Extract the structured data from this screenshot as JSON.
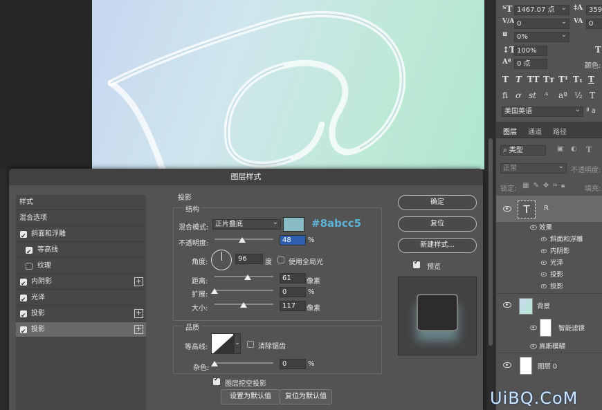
{
  "right_panel": {
    "font_size": "1467.07 点",
    "leading_partial": "359",
    "kerning": "0",
    "tracking": "0",
    "tsume": "0%",
    "vertical_scale": "100%",
    "baseline_shift": "0 点",
    "color_label": "颜色:",
    "language": "美国英语",
    "aa_label": "ª a",
    "tabs": [
      "图层",
      "通道",
      "路径"
    ],
    "filter_kind": "类型",
    "blend_mode": "正常",
    "opacity_label": "不透明度:",
    "lock_label": "锁定:",
    "fill_label": "填充:",
    "layers": {
      "text_layer": "R",
      "effects_label": "效果",
      "effects": [
        "斜面和浮雕",
        "内阴影",
        "光泽",
        "投影",
        "投影"
      ],
      "background": "背景",
      "smart_filter": "智能滤镜",
      "gaussian_blur": "高斯模糊",
      "layer0": "图层 0"
    }
  },
  "dialog": {
    "title": "图层样式",
    "style_list": [
      {
        "label": "样式",
        "checkbox": "none"
      },
      {
        "label": "混合选项",
        "checkbox": "none"
      },
      {
        "label": "斜面和浮雕",
        "checkbox": "on"
      },
      {
        "label": "等高线",
        "checkbox": "on"
      },
      {
        "label": "纹理",
        "checkbox": "off"
      },
      {
        "label": "内阴影",
        "checkbox": "on",
        "plus": "+"
      },
      {
        "label": "光泽",
        "checkbox": "on"
      },
      {
        "label": "投影",
        "checkbox": "on",
        "plus": "+"
      },
      {
        "label": "投影",
        "checkbox": "on",
        "plus": "+",
        "selected": true
      }
    ],
    "section_title": "投影",
    "structure_title": "结构",
    "blend_mode_label": "混合模式:",
    "blend_mode": "正片叠底",
    "color_hex": "#8abcc5",
    "opacity_label": "不透明度:",
    "opacity": "48",
    "percent": "%",
    "angle_label": "角度:",
    "angle": "96",
    "degree": "度",
    "global_light": "使用全局光",
    "distance_label": "距离:",
    "distance": "61",
    "px": "像素",
    "spread_label": "扩展:",
    "spread": "0",
    "size_label": "大小:",
    "size": "117",
    "quality_title": "品质",
    "contour_label": "等高线:",
    "antialias": "消除锯齿",
    "noise_label": "杂色:",
    "noise": "0",
    "knockout": "图层挖空投影",
    "make_default": "设置为默认值",
    "reset_default": "复位为默认值",
    "ok": "确定",
    "reset": "复位",
    "new_style": "新建样式...",
    "preview": "预览"
  },
  "watermark": "UiBQ.CoM",
  "colors": {
    "swatch": "#8abcc5",
    "accent": "#3a7bd5"
  }
}
